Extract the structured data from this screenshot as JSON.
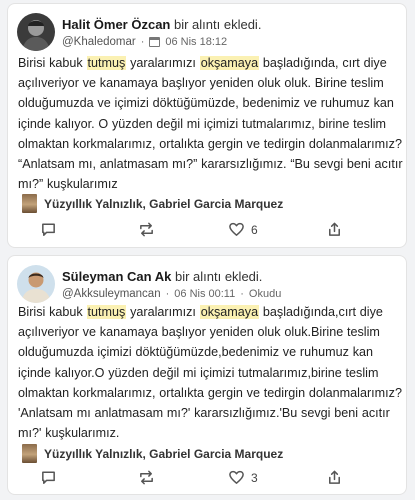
{
  "posts": [
    {
      "author": "Halit Ömer Özcan",
      "action_text": "bir alıntı ekledi.",
      "handle": "@Khaledomar",
      "date": "06 Nis 18:12",
      "read_status": "",
      "text_parts": [
        "Birisi kabuk ",
        "tutmuş",
        " yaralarımızı ",
        "okşamaya",
        " başladığında, cırt diye açılıveriyor ve kanamaya başlıyor yeniden oluk oluk. Birine teslim olduğumuzda ve içimizi döktüğümüzde, bedenimiz ve ruhumuz kan içinde kalıyor. O yüzden değil mi içimizi tutmalarımız, birine teslim olmaktan korkmalarımız, ortalıkta gergin ve tedirgin dolanmalarımız? “Anlatsam mı, anlatmasam mı?” kararsızlığımız. “Bu sevgi beni acıtır mı?” kuşkularımız"
      ],
      "book": "Yüzyıllık Yalnızlık, Gabriel Garcia Marquez",
      "like_count": "6"
    },
    {
      "author": "Süleyman Can Ak",
      "action_text": "bir alıntı ekledi.",
      "handle": "@Akksuleymancan",
      "date": "06 Nis 00:11",
      "read_status": "Okudu",
      "text_parts": [
        "Birisi kabuk ",
        "tutmuş",
        " yaralarımızı ",
        "okşamaya",
        " başladığında,cırt diye açılıveriyor ve kanamaya başlıyor yeniden oluk oluk.Birine teslim olduğumuzda içimizi döktüğümüzde,bedenimiz ve ruhumuz kan içinde kalıyor.O yüzden değil mi içimizi tutmalarımız,birine teslim olmaktan korkmalarımız, ortalıkta gergin ve tedirgin dolanmalarımız? 'Anlatsam mı anlatmasam mı?' kararsızlığımız.'Bu sevgi beni acıtır mı?' kuşkularımız."
      ],
      "book": "Yüzyıllık Yalnızlık, Gabriel Garcia Marquez",
      "like_count": "3"
    }
  ],
  "icons": [
    "comment-icon",
    "repost-icon",
    "like-icon",
    "share-icon",
    "calendar-icon"
  ],
  "colors": {
    "highlight": "#fbf1b3",
    "card": "#ffffff",
    "background": "#f2f3f5"
  }
}
